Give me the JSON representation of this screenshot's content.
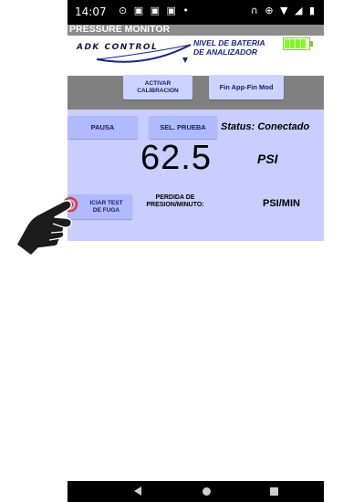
{
  "status_bar": {
    "time": "14:07",
    "notification_icons": "⊙ ▣ ▣ ▣ •",
    "system_icons": "∩ ⊕ ▼ ◢ ▮"
  },
  "app": {
    "title": "PRESSURE MONITOR"
  },
  "header": {
    "logo_text": "ADK CONTROL",
    "battery_label_line1": "NIVEL DE BATERIA",
    "battery_label_line2": "DE ANALIZADOR",
    "battery_level_fraction": 1.0,
    "battery_color": "#7dff1a"
  },
  "buttons": {
    "activar_line1": "ACTIVAR",
    "activar_line2": "CALIBRACION",
    "fin": "Fin App-Fin Mod",
    "pausa": "PAUSA",
    "sel_prueba": "SEL. PRUEBA",
    "test_line1": "ICIAR TEST",
    "test_line2": "DE FUGA"
  },
  "status": {
    "text": "Status: Conectado"
  },
  "reading": {
    "value": "62.5",
    "unit": "PSI"
  },
  "leak": {
    "label_line1": "PERDIDA DE",
    "label_line2": "PRESION/MINUTO:",
    "unit": "PSI/MIN"
  },
  "colors": {
    "title_bar": "#8c8c8c",
    "gray_panel": "#808080",
    "blue_panel": "#c9cdff",
    "button": "#ccd3ff"
  }
}
